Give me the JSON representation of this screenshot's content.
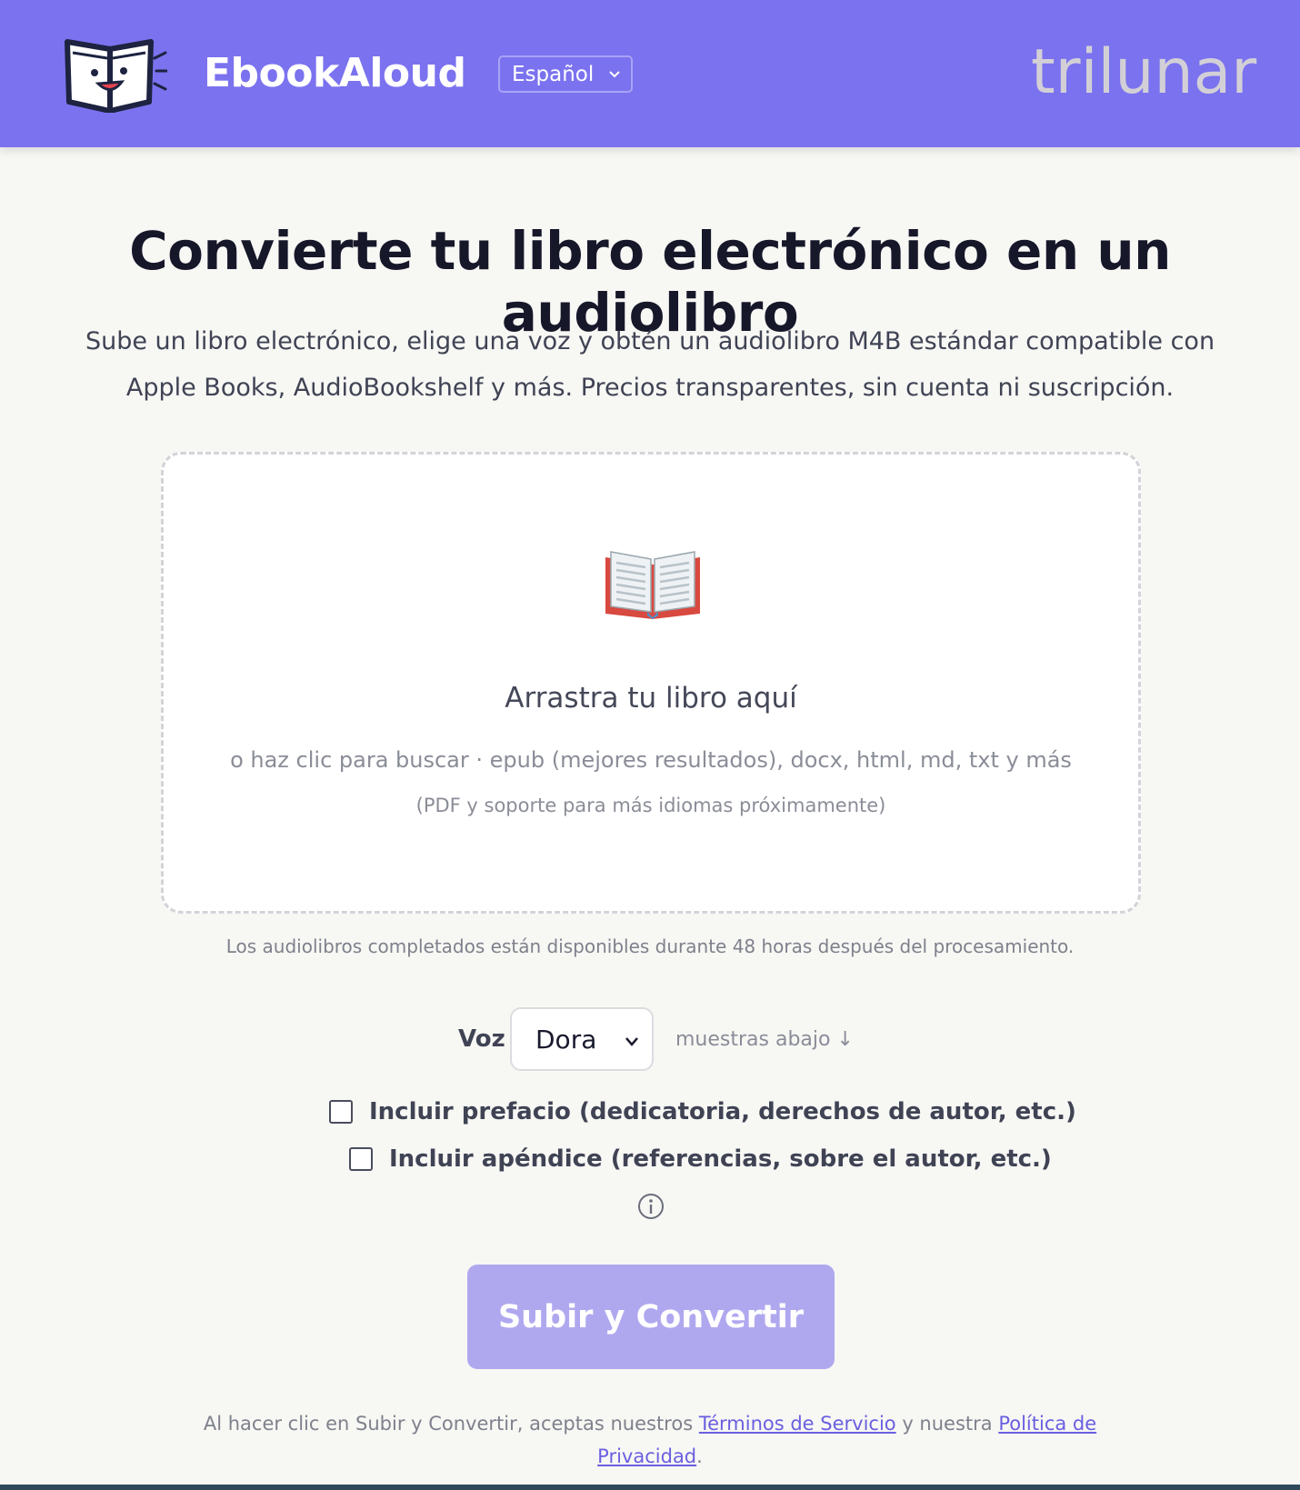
{
  "header": {
    "brand": "EbookAloud",
    "language_selected": "Español",
    "partner_logo": "trilunar",
    "colors": {
      "header_bg": "#7b72ef"
    },
    "icons": {
      "logo": "book-mascot-icon",
      "language_dropdown": "chevron-down-icon"
    }
  },
  "hero": {
    "title": "Convierte tu libro electrónico en un audiolibro",
    "subtitle": "Sube un libro electrónico, elige una voz y obtén un audiolibro M4B estándar compatible con Apple Books, AudioBookshelf y más. Precios transparentes, sin cuenta ni suscripción."
  },
  "dropzone": {
    "icon": "open-book-icon",
    "title": "Arrastra tu libro aquí",
    "formats": "o haz clic para buscar · epub (mejores resultados), docx, html, md, txt y más",
    "note": "(PDF y soporte para más idiomas próximamente)"
  },
  "availability_note": "Los audiolibros completados están disponibles durante 48 horas después del procesamiento.",
  "options": {
    "voice_label": "Voz",
    "voice_selected": "Dora",
    "samples_hint": "muestras abajo ↓",
    "include_preface": {
      "label": "Incluir prefacio (dedicatoria, derechos de autor, etc.)",
      "checked": false
    },
    "include_appendix": {
      "label": "Incluir apéndice (referencias, sobre el autor, etc.)",
      "checked": false
    },
    "info_icon": "info-icon"
  },
  "cta": {
    "label": "Subir y Convertir",
    "color": "#b0a8ef"
  },
  "legal": {
    "prefix": "Al hacer clic en Subir y Convertir, aceptas nuestros ",
    "terms_link": "Términos de Servicio",
    "middle": " y nuestra ",
    "privacy_link": "Política de Privacidad",
    "suffix": "."
  }
}
